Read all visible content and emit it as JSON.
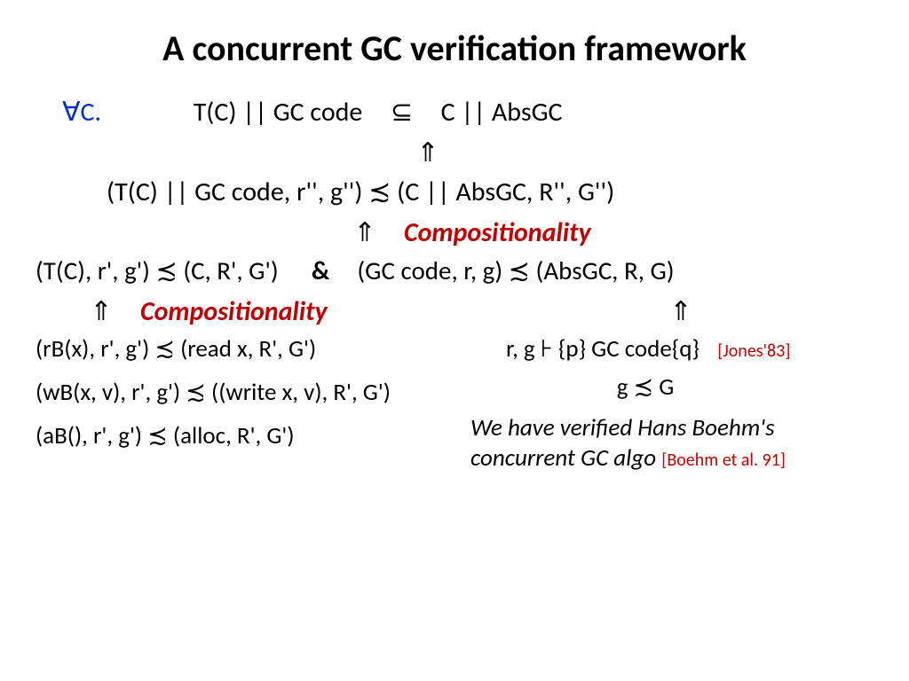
{
  "title": "A concurrent GC verification framework",
  "line1_forall": "∀C.",
  "line1_lhs": "T(C) || GC code",
  "line1_sub": "⊆",
  "line1_rhs": "C || AbsGC",
  "up": "⇑",
  "line2": "(T(C) || GC code, r'', g'') ≾ (C || AbsGC, R'', G'')",
  "comp": "Compositionality",
  "line3_left": "(T(C), r', g') ≾ (C, R', G')",
  "amp": "&",
  "line3_right": "(GC code, r, g) ≾ (AbsGC, R, G)",
  "left_items": [
    "(rB(x), r', g') ≾ (read x, R', G')",
    "(wB(x, v), r', g') ≾ ((write x, v), R', G')",
    "(aB(), r', g') ≾ (alloc, R', G')"
  ],
  "right_rg": "r, g  ⊦  {p} GC code{q}",
  "right_rg_cite": "[Jones'83]",
  "right_gG": "g  ≾  G",
  "footnote_a": "We have verified Hans Boehm's concurrent GC algo ",
  "footnote_cite": "[Boehm et al. 91]"
}
